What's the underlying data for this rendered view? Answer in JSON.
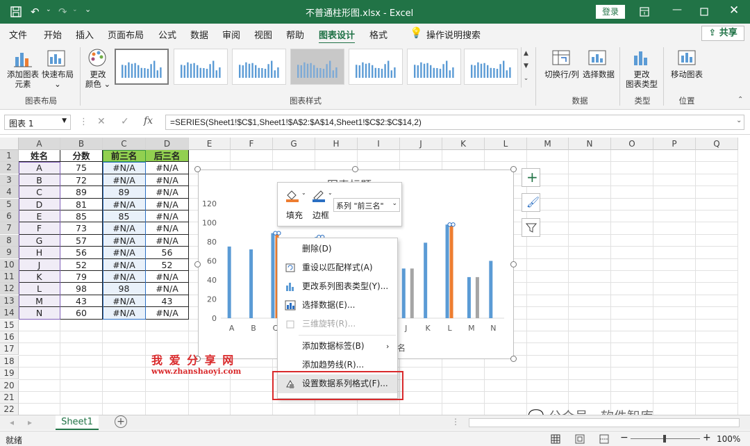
{
  "window": {
    "title": "不普通柱形图.xlsx  -  Excel",
    "login": "登录"
  },
  "tabs": [
    "文件",
    "开始",
    "插入",
    "页面布局",
    "公式",
    "数据",
    "审阅",
    "视图",
    "帮助",
    "图表设计",
    "格式"
  ],
  "tell_me": "操作说明搜索",
  "share": "共享",
  "ribbon": {
    "add_element": "添加图表",
    "add_element2": "元素",
    "quick_layout": "快速布局",
    "change_color": "更改",
    "change_color2": "颜色",
    "switch_row_col": "切换行/列",
    "select_data": "选择数据",
    "change_type": "更改",
    "change_type2": "图表类型",
    "move_chart": "移动图表",
    "groups": {
      "layout": "图表布局",
      "styles": "图表样式",
      "data": "数据",
      "type": "类型",
      "location": "位置"
    }
  },
  "formula_bar": {
    "name_box": "图表 1",
    "fx": "fx",
    "formula": "=SERIES(Sheet1!$C$1,Sheet1!$A$2:$A$14,Sheet1!$C$2:$C$14,2)"
  },
  "columns": [
    "A",
    "B",
    "C",
    "D",
    "E",
    "F",
    "G",
    "H",
    "I",
    "J",
    "K",
    "L",
    "M",
    "N",
    "O",
    "P",
    "Q"
  ],
  "rows": [
    "1",
    "2",
    "3",
    "4",
    "5",
    "6",
    "7",
    "8",
    "9",
    "10",
    "11",
    "12",
    "13",
    "14",
    "15",
    "16",
    "17",
    "18",
    "19",
    "20",
    "21",
    "22"
  ],
  "table": {
    "headers": [
      "姓名",
      "分数",
      "前三名",
      "后三名"
    ],
    "data": [
      [
        "A",
        "75",
        "#N/A",
        "#N/A"
      ],
      [
        "B",
        "72",
        "#N/A",
        "#N/A"
      ],
      [
        "C",
        "89",
        "89",
        "#N/A"
      ],
      [
        "D",
        "81",
        "#N/A",
        "#N/A"
      ],
      [
        "E",
        "85",
        "85",
        "#N/A"
      ],
      [
        "F",
        "73",
        "#N/A",
        "#N/A"
      ],
      [
        "G",
        "57",
        "#N/A",
        "#N/A"
      ],
      [
        "H",
        "56",
        "#N/A",
        "56"
      ],
      [
        "J",
        "52",
        "#N/A",
        "52"
      ],
      [
        "K",
        "79",
        "#N/A",
        "#N/A"
      ],
      [
        "L",
        "98",
        "98",
        "#N/A"
      ],
      [
        "M",
        "43",
        "#N/A",
        "43"
      ],
      [
        "N",
        "60",
        "#N/A",
        "#N/A"
      ]
    ]
  },
  "chart": {
    "title": "图表标题",
    "axis_hint": "名"
  },
  "chart_data": {
    "type": "bar",
    "categories": [
      "A",
      "B",
      "C",
      "D",
      "E",
      "F",
      "G",
      "H",
      "J",
      "K",
      "L",
      "M",
      "N"
    ],
    "ylim": [
      0,
      120
    ],
    "yticks": [
      "0",
      "20",
      "40",
      "60",
      "80",
      "100",
      "120"
    ],
    "series": [
      {
        "name": "分数",
        "values": [
          75,
          72,
          89,
          81,
          85,
          73,
          57,
          56,
          52,
          79,
          98,
          43,
          60
        ]
      },
      {
        "name": "前三名",
        "values": [
          null,
          null,
          89,
          null,
          85,
          null,
          null,
          null,
          null,
          null,
          98,
          null,
          null
        ]
      },
      {
        "name": "后三名",
        "values": [
          null,
          null,
          null,
          null,
          null,
          null,
          null,
          56,
          52,
          null,
          null,
          43,
          null
        ]
      }
    ],
    "colors": [
      "#5b9bd5",
      "#ed7d31",
      "#a5a5a5"
    ]
  },
  "minibar": {
    "fill": "填充",
    "border": "边框",
    "series_select": "系列 \"前三名\""
  },
  "context_menu": [
    {
      "label": "删除(D)",
      "icon": "none",
      "disabled": false
    },
    {
      "label": "重设以匹配样式(A)",
      "icon": "reset-style-icon",
      "disabled": false
    },
    {
      "label": "更改系列图表类型(Y)...",
      "icon": "chart-type-icon",
      "disabled": false
    },
    {
      "label": "选择数据(E)...",
      "icon": "select-data-icon",
      "disabled": false
    },
    {
      "label": "三维旋转(R)...",
      "icon": "rotate-3d-icon",
      "disabled": true
    },
    {
      "label": "添加数据标签(B)",
      "icon": "none",
      "disabled": false,
      "submenu": true
    },
    {
      "label": "添加趋势线(R)...",
      "icon": "none",
      "disabled": false
    },
    {
      "label": "设置数据系列格式(F)...",
      "icon": "format-series-icon",
      "disabled": false
    }
  ],
  "sheet": {
    "tab": "Sheet1"
  },
  "status": {
    "left": "就绪",
    "zoom": "100%"
  },
  "watermark": {
    "cn": "我 爱 分 享 网",
    "url": "www.zhanshaoyi.com",
    "wechat": "公众号 · 软件智库"
  }
}
